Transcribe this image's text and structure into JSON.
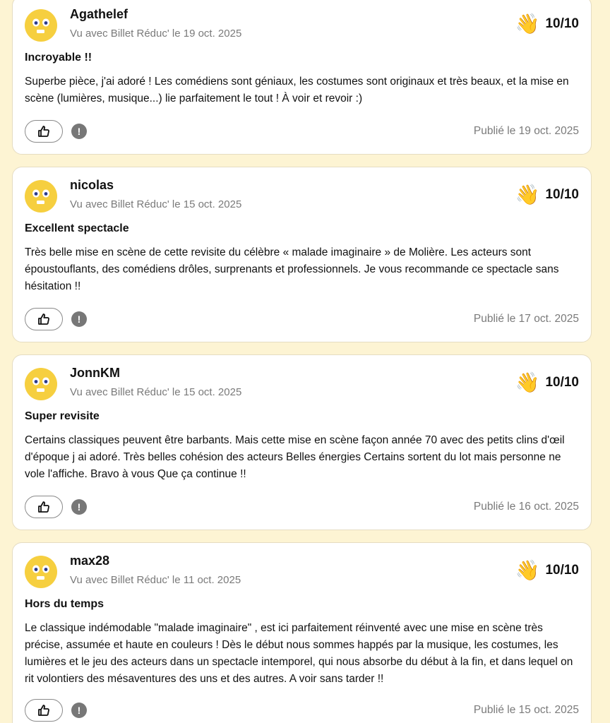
{
  "reviews": [
    {
      "username": "Agathelef",
      "seen": "Vu avec Billet Réduc' le 19 oct. 2025",
      "rating": "10/10",
      "title": "Incroyable !!",
      "body": "Superbe pièce, j'ai adoré ! Les comédiens sont géniaux, les costumes sont originaux et très beaux, et la mise en scène (lumières, musique...) lie parfaitement le tout ! À voir et revoir :)",
      "published": "Publié le 19 oct. 2025"
    },
    {
      "username": "nicolas",
      "seen": "Vu avec Billet Réduc' le 15 oct. 2025",
      "rating": "10/10",
      "title": "Excellent spectacle",
      "body": "Très belle mise en scène de cette revisite du célèbre « malade imaginaire » de Molière. Les acteurs sont époustouflants, des comédiens drôles, surprenants et professionnels. Je vous recommande ce spectacle sans hésitation !!",
      "published": "Publié le 17 oct. 2025"
    },
    {
      "username": "JonnKM",
      "seen": "Vu avec Billet Réduc' le 15 oct. 2025",
      "rating": "10/10",
      "title": "Super revisite",
      "body": "Certains classiques peuvent être barbants. Mais cette mise en scène façon année 70 avec des petits clins d'œil d'époque j ai adoré. Très belles cohésion des acteurs Belles énergies Certains sortent du lot mais personne ne vole l'affiche. Bravo à vous Que ça continue !!",
      "published": "Publié le 16 oct. 2025"
    },
    {
      "username": "max28",
      "seen": "Vu avec Billet Réduc' le 11 oct. 2025",
      "rating": "10/10",
      "title": "Hors du temps",
      "body": "Le classique indémodable \"malade imaginaire\" , est ici parfaitement réinventé avec une mise en scène très précise, assumée et haute en couleurs ! Dès le début nous sommes happés par la musique, les costumes, les lumières et le jeu des acteurs dans un spectacle intemporel, qui nous absorbe du début à la fin, et dans lequel on rit volontiers des mésaventures des uns et des autres. A voir sans tarder !!",
      "published": "Publié le 15 oct. 2025"
    }
  ],
  "icons": {
    "avatar": "smiley-face-icon",
    "rating": "waving-hand-icon",
    "like": "thumbs-up-icon",
    "report": "exclamation-icon"
  },
  "colors": {
    "page_background": "#fdf4d3",
    "card_background": "#ffffff",
    "avatar_yellow": "#f6cf3f",
    "muted_text": "#7a7a7a",
    "report_grey": "#777777"
  }
}
